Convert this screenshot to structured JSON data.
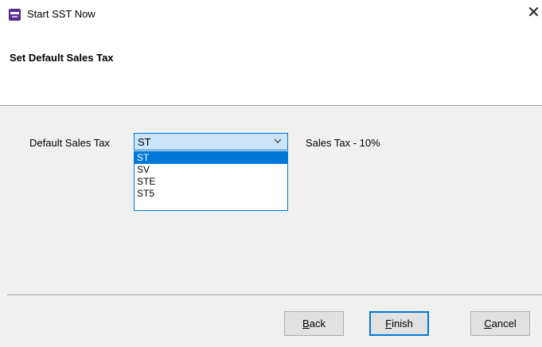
{
  "window": {
    "title": "Start SST Now",
    "close_glyph": "✕"
  },
  "header": {
    "title": "Set Default Sales Tax"
  },
  "form": {
    "label": "Default Sales Tax",
    "selected": "ST",
    "description": "Sales Tax - 10%",
    "options": [
      "ST",
      "SV",
      "STE",
      "ST5"
    ]
  },
  "buttons": {
    "back": {
      "mnemonic": "B",
      "rest": "ack"
    },
    "finish": {
      "mnemonic": "F",
      "rest": "inish"
    },
    "cancel": {
      "mnemonic": "C",
      "rest": "ancel"
    }
  },
  "colors": {
    "accent": "#0078d7",
    "combo_bg": "#cce4f7",
    "panel_bg": "#f0f0f0"
  }
}
